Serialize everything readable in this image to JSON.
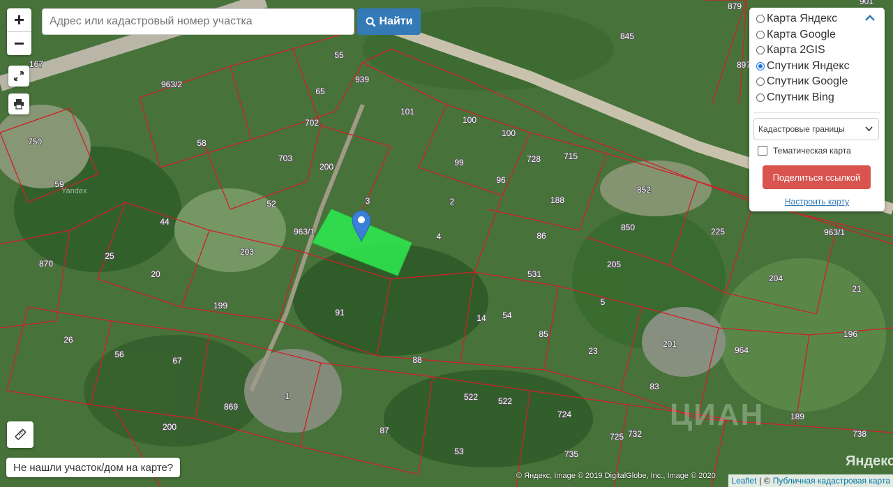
{
  "search": {
    "placeholder": "Адрес или кадастровый номер участка",
    "button_label": "Найти"
  },
  "zoom": {
    "in": "+",
    "out": "−"
  },
  "layers": {
    "options": [
      "Карта Яндекс",
      "Карта Google",
      "Карта 2GIS",
      "Спутник Яндекс",
      "Спутник Google",
      "Спутник Bing"
    ],
    "selected": "Спутник Яндекс",
    "overlay_select": "Кадастровые границы",
    "thematic_label": "Тематическая карта",
    "share_label": "Поделиться ссылкой",
    "configure_label": "Настроить карту"
  },
  "not_found_label": "Не нашли участок/дом на карте?",
  "attribution": {
    "leaflet": "Leaflet",
    "separator": "| ©",
    "source": "Публичная кадастровая карта"
  },
  "yandex_copyright": "© Яндекс, Image © 2019 DigitalGlobe, Inc., Image © 2020",
  "watermarks": {
    "yandex": "Яндекс",
    "cian": "ЦИАН",
    "yandex_tile": "Yandex"
  },
  "parcels": [
    "879",
    "901",
    "845",
    "897",
    "167",
    "963/2",
    "55",
    "939",
    "65",
    "750",
    "702",
    "101",
    "100",
    "100",
    "58",
    "703",
    "200",
    "99",
    "728",
    "715",
    "59",
    "52",
    "3",
    "96",
    "2",
    "852",
    "188",
    "225",
    "963/1",
    "963/1",
    "4",
    "86",
    "850",
    "44",
    "870",
    "25",
    "203",
    "205",
    "531",
    "20",
    "204",
    "21",
    "5",
    "199",
    "91",
    "54",
    "14",
    "85",
    "26",
    "56",
    "201",
    "67",
    "88",
    "196",
    "23",
    "964",
    "1",
    "869",
    "83",
    "522",
    "522",
    "724",
    "189",
    "738",
    "200",
    "87",
    "732",
    "725",
    "53",
    "735"
  ],
  "colors": {
    "selected_parcel": "#2ee84e",
    "parcel_border": "#d0202a",
    "accent": "#337ab7",
    "share": "#d9534f",
    "marker": "#3a7fd8"
  }
}
